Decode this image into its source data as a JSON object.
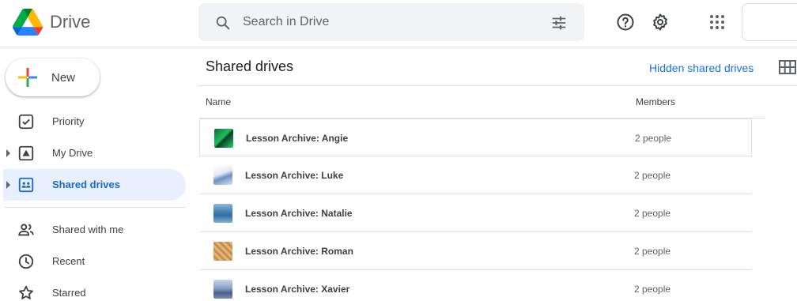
{
  "header": {
    "brand": "Drive",
    "search_placeholder": "Search in Drive"
  },
  "sidebar": {
    "new_label": "New",
    "items": [
      {
        "label": "Priority",
        "icon": "priority-check-icon"
      },
      {
        "label": "My Drive",
        "icon": "my-drive-icon"
      },
      {
        "label": "Shared drives",
        "icon": "shared-drives-icon",
        "active": true
      },
      {
        "label": "Shared with me",
        "icon": "people-icon"
      },
      {
        "label": "Recent",
        "icon": "clock-icon"
      },
      {
        "label": "Starred",
        "icon": "star-icon"
      }
    ]
  },
  "main": {
    "title": "Shared drives",
    "hidden_link": "Hidden shared drives",
    "columns": {
      "name": "Name",
      "members": "Members"
    },
    "rows": [
      {
        "name": "Lesson Archive: Angie",
        "members": "2 people"
      },
      {
        "name": "Lesson Archive: Luke",
        "members": "2 people"
      },
      {
        "name": "Lesson Archive: Natalie",
        "members": "2 people"
      },
      {
        "name": "Lesson Archive: Roman",
        "members": "2 people"
      },
      {
        "name": "Lesson Archive: Xavier",
        "members": "2 people"
      }
    ]
  },
  "colors": {
    "accent_blue": "#1a73e8",
    "active_bg": "#e8f0fe",
    "active_text": "#1967d2"
  }
}
